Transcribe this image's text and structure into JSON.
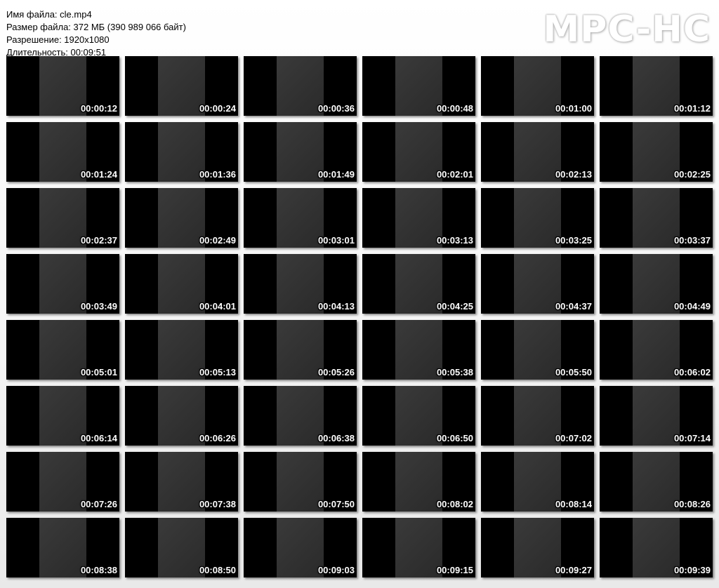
{
  "info": {
    "filename": "Имя файла: cle.mp4",
    "filesize": "Размер файла: 372 МБ (390 989 066 байт)",
    "resolution": "Разрешение: 1920x1080",
    "duration": "Длительность: 00:09:51"
  },
  "logo": "MPC-HC",
  "thumbnails": [
    "00:00:12",
    "00:00:24",
    "00:00:36",
    "00:00:48",
    "00:01:00",
    "00:01:12",
    "00:01:24",
    "00:01:36",
    "00:01:49",
    "00:02:01",
    "00:02:13",
    "00:02:25",
    "00:02:37",
    "00:02:49",
    "00:03:01",
    "00:03:13",
    "00:03:25",
    "00:03:37",
    "00:03:49",
    "00:04:01",
    "00:04:13",
    "00:04:25",
    "00:04:37",
    "00:04:49",
    "00:05:01",
    "00:05:13",
    "00:05:26",
    "00:05:38",
    "00:05:50",
    "00:06:02",
    "00:06:14",
    "00:06:26",
    "00:06:38",
    "00:06:50",
    "00:07:02",
    "00:07:14",
    "00:07:26",
    "00:07:38",
    "00:07:50",
    "00:08:02",
    "00:08:14",
    "00:08:26",
    "00:08:38",
    "00:08:50",
    "00:09:03",
    "00:09:15",
    "00:09:27",
    "00:09:39"
  ]
}
